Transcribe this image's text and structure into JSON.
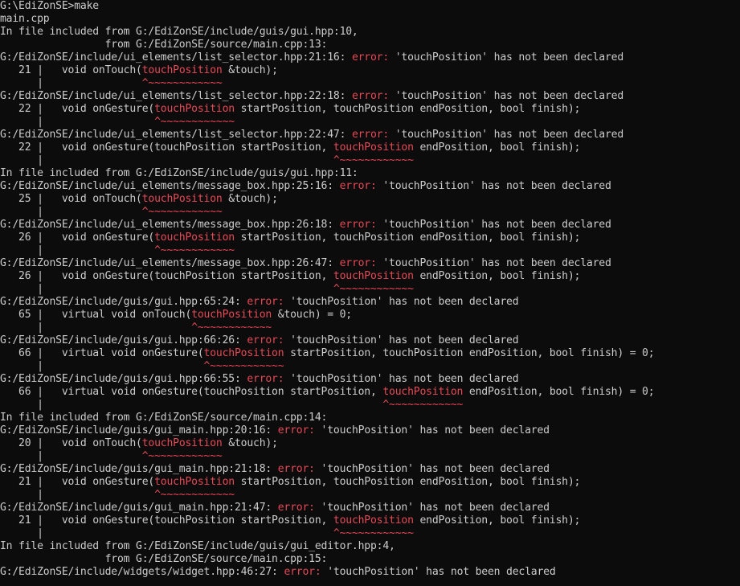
{
  "colors": {
    "background": "#0c0c0c",
    "text": "#cccccc",
    "error": "#e74856"
  },
  "terminal": {
    "lines": [
      [
        {
          "t": "G:\\EdiZonSE>make"
        }
      ],
      [
        {
          "t": "main.cpp"
        }
      ],
      [
        {
          "t": "In file included from G:/EdiZonSE/include/guis/gui.hpp:10,"
        }
      ],
      [
        {
          "t": "                 from G:/EdiZonSE/source/main.cpp:13:"
        }
      ],
      [
        {
          "t": "G:/EdiZonSE/include/ui_elements/list_selector.hpp:21:16: "
        },
        {
          "t": "error:",
          "c": "err"
        },
        {
          "t": " 'touchPosition' has not been declared"
        }
      ],
      [
        {
          "t": "   21 |   void onTouch("
        },
        {
          "t": "touchPosition",
          "c": "err"
        },
        {
          "t": " &touch);"
        }
      ],
      [
        {
          "t": "      |                "
        },
        {
          "t": "^~~~~~~~~~~~~",
          "c": "err"
        }
      ],
      [
        {
          "t": "G:/EdiZonSE/include/ui_elements/list_selector.hpp:22:18: "
        },
        {
          "t": "error:",
          "c": "err"
        },
        {
          "t": " 'touchPosition' has not been declared"
        }
      ],
      [
        {
          "t": "   22 |   void onGesture("
        },
        {
          "t": "touchPosition",
          "c": "err"
        },
        {
          "t": " startPosition, touchPosition endPosition, bool finish);"
        }
      ],
      [
        {
          "t": "      |                  "
        },
        {
          "t": "^~~~~~~~~~~~~",
          "c": "err"
        }
      ],
      [
        {
          "t": "G:/EdiZonSE/include/ui_elements/list_selector.hpp:22:47: "
        },
        {
          "t": "error:",
          "c": "err"
        },
        {
          "t": " 'touchPosition' has not been declared"
        }
      ],
      [
        {
          "t": "   22 |   void onGesture(touchPosition startPosition, "
        },
        {
          "t": "touchPosition",
          "c": "err"
        },
        {
          "t": " endPosition, bool finish);"
        }
      ],
      [
        {
          "t": "      |                                               "
        },
        {
          "t": "^~~~~~~~~~~~~",
          "c": "err"
        }
      ],
      [
        {
          "t": "In file included from G:/EdiZonSE/include/guis/gui.hpp:11:"
        }
      ],
      [
        {
          "t": "G:/EdiZonSE/include/ui_elements/message_box.hpp:25:16: "
        },
        {
          "t": "error:",
          "c": "err"
        },
        {
          "t": " 'touchPosition' has not been declared"
        }
      ],
      [
        {
          "t": "   25 |   void onTouch("
        },
        {
          "t": "touchPosition",
          "c": "err"
        },
        {
          "t": " &touch);"
        }
      ],
      [
        {
          "t": "      |                "
        },
        {
          "t": "^~~~~~~~~~~~~",
          "c": "err"
        }
      ],
      [
        {
          "t": "G:/EdiZonSE/include/ui_elements/message_box.hpp:26:18: "
        },
        {
          "t": "error:",
          "c": "err"
        },
        {
          "t": " 'touchPosition' has not been declared"
        }
      ],
      [
        {
          "t": "   26 |   void onGesture("
        },
        {
          "t": "touchPosition",
          "c": "err"
        },
        {
          "t": " startPosition, touchPosition endPosition, bool finish);"
        }
      ],
      [
        {
          "t": "      |                  "
        },
        {
          "t": "^~~~~~~~~~~~~",
          "c": "err"
        }
      ],
      [
        {
          "t": "G:/EdiZonSE/include/ui_elements/message_box.hpp:26:47: "
        },
        {
          "t": "error:",
          "c": "err"
        },
        {
          "t": " 'touchPosition' has not been declared"
        }
      ],
      [
        {
          "t": "   26 |   void onGesture(touchPosition startPosition, "
        },
        {
          "t": "touchPosition",
          "c": "err"
        },
        {
          "t": " endPosition, bool finish);"
        }
      ],
      [
        {
          "t": "      |                                               "
        },
        {
          "t": "^~~~~~~~~~~~~",
          "c": "err"
        }
      ],
      [
        {
          "t": "G:/EdiZonSE/include/guis/gui.hpp:65:24: "
        },
        {
          "t": "error:",
          "c": "err"
        },
        {
          "t": " 'touchPosition' has not been declared"
        }
      ],
      [
        {
          "t": "   65 |   virtual void onTouch("
        },
        {
          "t": "touchPosition",
          "c": "err"
        },
        {
          "t": " &touch) = 0;"
        }
      ],
      [
        {
          "t": "      |                        "
        },
        {
          "t": "^~~~~~~~~~~~~",
          "c": "err"
        }
      ],
      [
        {
          "t": "G:/EdiZonSE/include/guis/gui.hpp:66:26: "
        },
        {
          "t": "error:",
          "c": "err"
        },
        {
          "t": " 'touchPosition' has not been declared"
        }
      ],
      [
        {
          "t": "   66 |   virtual void onGesture("
        },
        {
          "t": "touchPosition",
          "c": "err"
        },
        {
          "t": " startPosition, touchPosition endPosition, bool finish) = 0;"
        }
      ],
      [
        {
          "t": "      |                          "
        },
        {
          "t": "^~~~~~~~~~~~~",
          "c": "err"
        }
      ],
      [
        {
          "t": "G:/EdiZonSE/include/guis/gui.hpp:66:55: "
        },
        {
          "t": "error:",
          "c": "err"
        },
        {
          "t": " 'touchPosition' has not been declared"
        }
      ],
      [
        {
          "t": "   66 |   virtual void onGesture(touchPosition startPosition, "
        },
        {
          "t": "touchPosition",
          "c": "err"
        },
        {
          "t": " endPosition, bool finish) = 0;"
        }
      ],
      [
        {
          "t": "      |                                                       "
        },
        {
          "t": "^~~~~~~~~~~~~",
          "c": "err"
        }
      ],
      [
        {
          "t": "In file included from G:/EdiZonSE/source/main.cpp:14:"
        }
      ],
      [
        {
          "t": "G:/EdiZonSE/include/guis/gui_main.hpp:20:16: "
        },
        {
          "t": "error:",
          "c": "err"
        },
        {
          "t": " 'touchPosition' has not been declared"
        }
      ],
      [
        {
          "t": "   20 |   void onTouch("
        },
        {
          "t": "touchPosition",
          "c": "err"
        },
        {
          "t": " &touch);"
        }
      ],
      [
        {
          "t": "      |                "
        },
        {
          "t": "^~~~~~~~~~~~~",
          "c": "err"
        }
      ],
      [
        {
          "t": "G:/EdiZonSE/include/guis/gui_main.hpp:21:18: "
        },
        {
          "t": "error:",
          "c": "err"
        },
        {
          "t": " 'touchPosition' has not been declared"
        }
      ],
      [
        {
          "t": "   21 |   void onGesture("
        },
        {
          "t": "touchPosition",
          "c": "err"
        },
        {
          "t": " startPosition, touchPosition endPosition, bool finish);"
        }
      ],
      [
        {
          "t": "      |                  "
        },
        {
          "t": "^~~~~~~~~~~~~",
          "c": "err"
        }
      ],
      [
        {
          "t": "G:/EdiZonSE/include/guis/gui_main.hpp:21:47: "
        },
        {
          "t": "error:",
          "c": "err"
        },
        {
          "t": " 'touchPosition' has not been declared"
        }
      ],
      [
        {
          "t": "   21 |   void onGesture(touchPosition startPosition, "
        },
        {
          "t": "touchPosition",
          "c": "err"
        },
        {
          "t": " endPosition, bool finish);"
        }
      ],
      [
        {
          "t": "      |                                               "
        },
        {
          "t": "^~~~~~~~~~~~~",
          "c": "err"
        }
      ],
      [
        {
          "t": "In file included from G:/EdiZonSE/include/guis/gui_editor.hpp:4,"
        }
      ],
      [
        {
          "t": "                 from G:/EdiZonSE/source/main.cpp:15:"
        }
      ],
      [
        {
          "t": "G:/EdiZonSE/include/widgets/widget.hpp:46:27: "
        },
        {
          "t": "error:",
          "c": "err"
        },
        {
          "t": " 'touchPosition' has not been declared"
        }
      ]
    ]
  }
}
